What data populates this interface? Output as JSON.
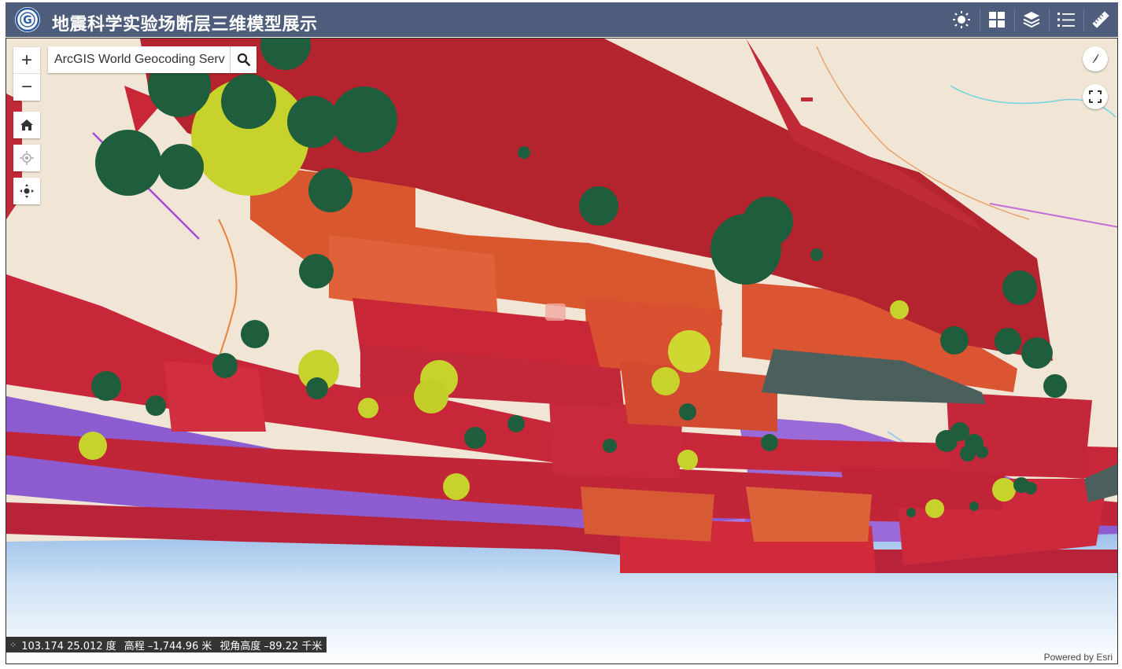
{
  "app": {
    "title": "地震科学实验场断层三维模型展示"
  },
  "header_buttons": [
    {
      "name": "brightness-icon"
    },
    {
      "name": "basemap-gallery-icon"
    },
    {
      "name": "layers-icon"
    },
    {
      "name": "legend-list-icon"
    },
    {
      "name": "measure-ruler-icon"
    }
  ],
  "map": {
    "zoom_in": "+",
    "zoom_out": "−",
    "search": {
      "value": "ArcGIS World Geocoding Serv",
      "placeholder": "ArcGIS World Geocoding Serv"
    },
    "status": {
      "coords": "103.174 25.012 度",
      "elevation": "高程 –1,744.96 米",
      "camera_height": "视角高度 –89.22 千米"
    },
    "attribution": "Powered by Esri"
  },
  "colors": {
    "header": "#4f5d7c",
    "fault_red": "#b3242e",
    "fault_orange": "#d9572f",
    "fault_purple": "#8c5cd0",
    "fault_slate": "#4b5f5c",
    "quake_green": "#1e5e3c",
    "quake_yellow": "#c8d22c",
    "basemap": "#f1e5d6",
    "sky": "#b9d6f2"
  }
}
